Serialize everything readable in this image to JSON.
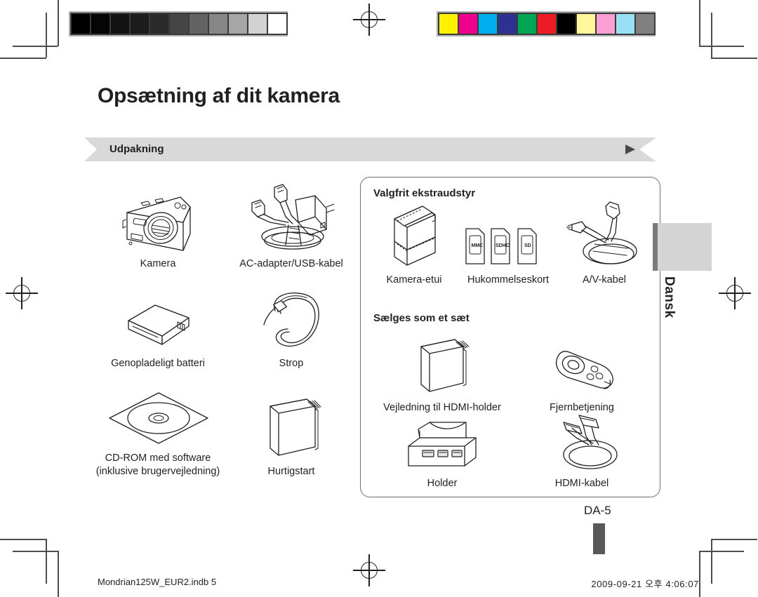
{
  "page": {
    "title": "Opsætning af dit kamera",
    "section_label": "Udpakning",
    "page_number": "DA-5",
    "language_tab": "Dansk"
  },
  "calibration": {
    "gray_swatches": [
      "#000000",
      "#050505",
      "#121212",
      "#1c1c1c",
      "#2b2b2b",
      "#454545",
      "#636363",
      "#878787",
      "#a6a6a6",
      "#d2d2d2",
      "#ffffff"
    ],
    "color_swatches": [
      "#fff200",
      "#ec008c",
      "#00aeef",
      "#2e3192",
      "#00a651",
      "#ed1c24",
      "#000000",
      "#fff799",
      "#f99fd4",
      "#99e0f7",
      "#808080"
    ]
  },
  "included_items": [
    {
      "caption": "Kamera",
      "icon": "camera-icon"
    },
    {
      "caption": "AC-adapter/USB-kabel",
      "icon": "ac-adapter-usb-cable-icon"
    },
    {
      "caption": "Genopladeligt batteri",
      "icon": "battery-icon"
    },
    {
      "caption": "Strop",
      "icon": "wrist-strap-icon"
    },
    {
      "caption": "CD-ROM med software\n(inklusive brugervejledning)",
      "icon": "cd-rom-icon"
    },
    {
      "caption": "Hurtigstart",
      "icon": "quick-start-guide-icon"
    }
  ],
  "optional_panel": {
    "heading": "Valgfrit ekstraudstyr",
    "items": [
      {
        "caption": "Kamera-etui",
        "icon": "camera-case-icon"
      },
      {
        "caption": "Hukommelseskort",
        "icon": "memory-card-icon",
        "card_labels": [
          "MMC",
          "SDHC",
          "SD"
        ]
      },
      {
        "caption": "A/V-kabel",
        "icon": "av-cable-icon"
      }
    ]
  },
  "set_panel": {
    "heading": "Sælges som et sæt",
    "items": [
      {
        "caption": "Vejledning til HDMI-holder",
        "icon": "hdmi-cradle-guide-icon"
      },
      {
        "caption": "Fjernbetjening",
        "icon": "remote-control-icon"
      },
      {
        "caption": "Holder",
        "icon": "cradle-icon"
      },
      {
        "caption": "HDMI-kabel",
        "icon": "hdmi-cable-icon"
      }
    ]
  },
  "footer": {
    "file_name": "Mondrian125W_EUR2.indb   5",
    "timestamp": "2009-09-21   오후 4:06:07"
  }
}
